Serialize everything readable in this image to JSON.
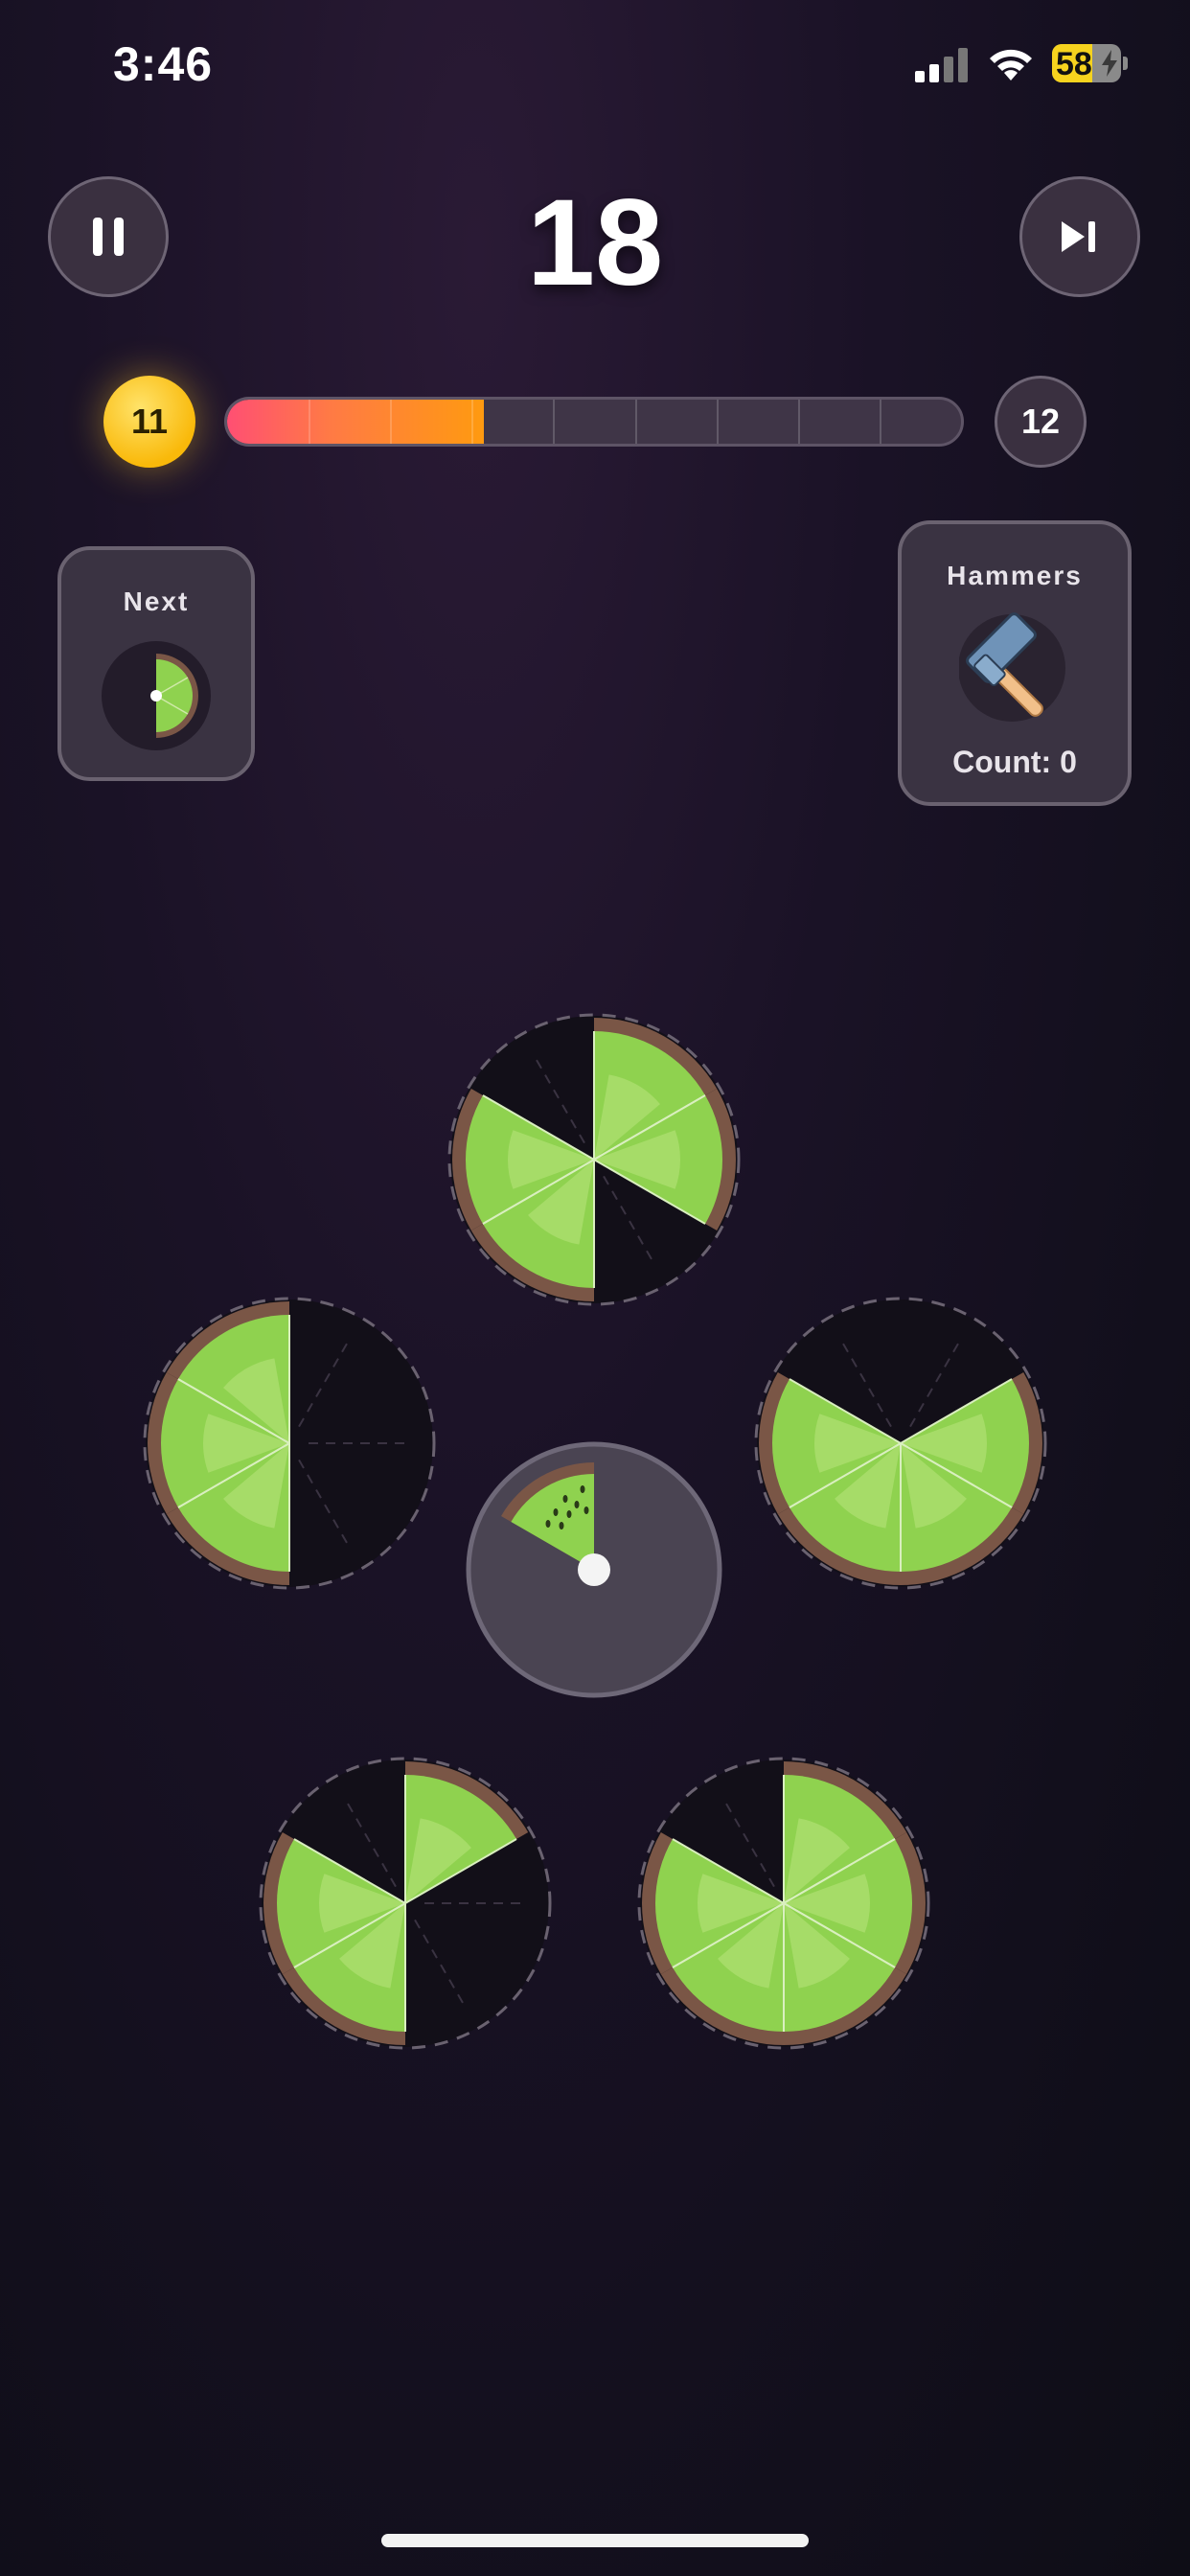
{
  "status_bar": {
    "time": "3:46",
    "battery_percent": "58",
    "battery_level": 0.58
  },
  "header": {
    "score": "18",
    "pause_icon": "pause-icon",
    "skip_icon": "skip-forward-icon"
  },
  "level": {
    "current": "11",
    "next": "12",
    "progress": 0.35,
    "segments": 9
  },
  "next_panel": {
    "title": "Next",
    "piece_slices": 3,
    "piece_icon": "kiwi-slice-icon"
  },
  "hammers_panel": {
    "title": "Hammers",
    "count_label": "Count: 0",
    "icon": "hammer-icon"
  },
  "board": {
    "slots": [
      {
        "name": "plate-top",
        "filled_slices": [
          0,
          1,
          3,
          4
        ]
      },
      {
        "name": "plate-left",
        "filled_slices": [
          3,
          4,
          5
        ]
      },
      {
        "name": "plate-right",
        "filled_slices": [
          1,
          2,
          3,
          4
        ]
      },
      {
        "name": "plate-bottom-left",
        "filled_slices": [
          0,
          3,
          4
        ]
      },
      {
        "name": "plate-bottom-right",
        "filled_slices": [
          0,
          1,
          2,
          3,
          4
        ]
      }
    ],
    "center_piece_slices": 1
  },
  "colors": {
    "kiwi": "#8fd24f",
    "kiwi_light": "#b8e37a",
    "rind": "#7a5646",
    "accent": "#f9b90a",
    "progress": "#ff7a45"
  }
}
